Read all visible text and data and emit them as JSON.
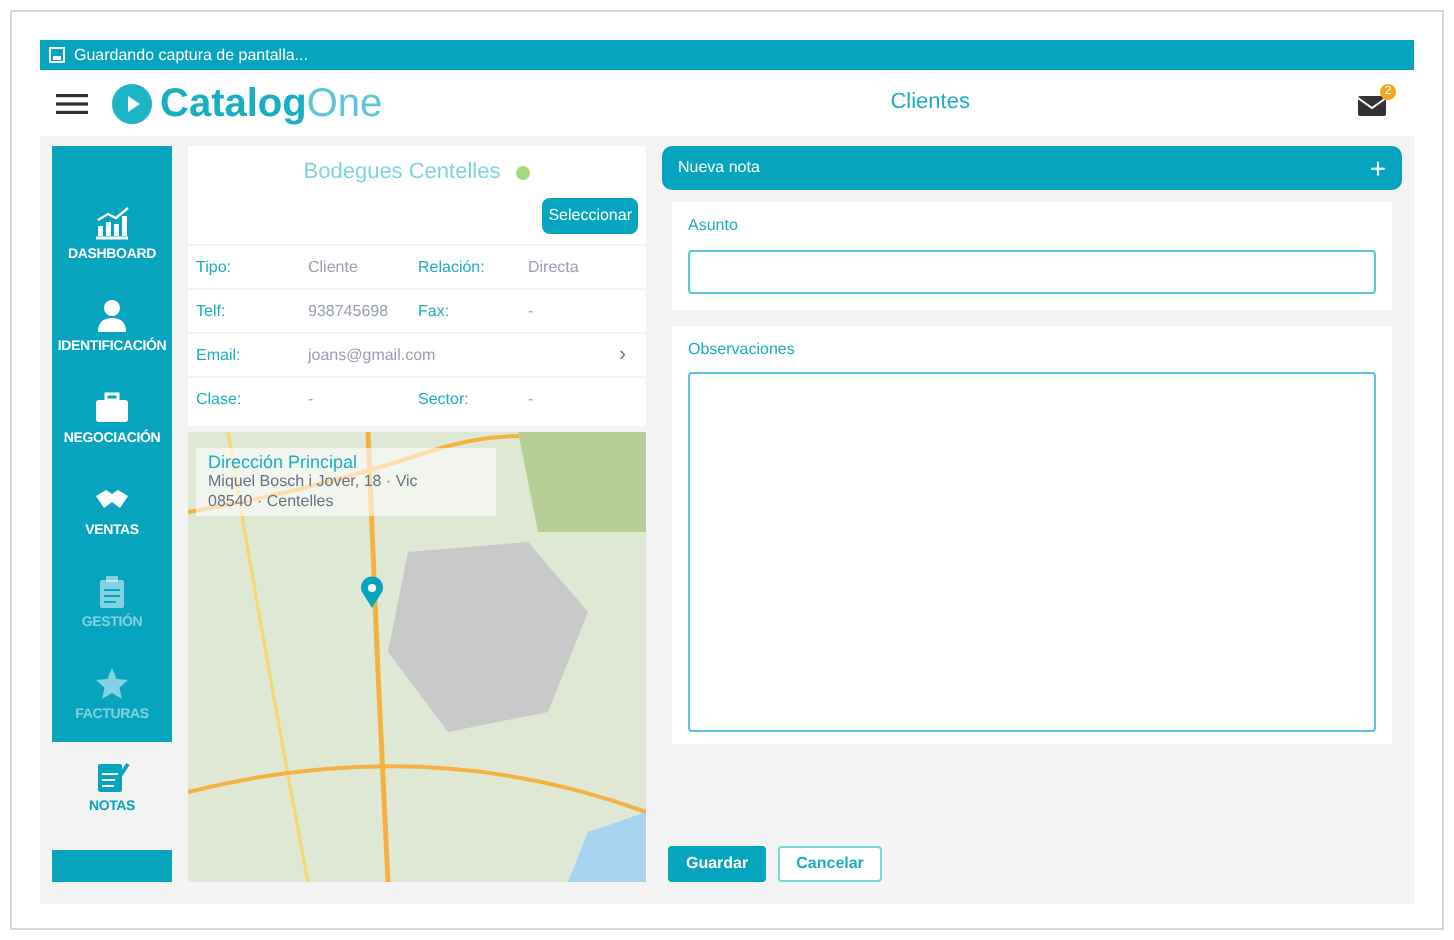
{
  "status_bar": {
    "text": "Guardando captura de pantalla..."
  },
  "header": {
    "logo_first": "Catalog",
    "logo_second": "One",
    "title": "Clientes",
    "notification_count": "2"
  },
  "sidebar": {
    "items": [
      {
        "label": "DASHBOARD",
        "selected": false,
        "disabled": false
      },
      {
        "label": "IDENTIFICACIÓN",
        "selected": false,
        "disabled": false
      },
      {
        "label": "NEGOCIACIÓN",
        "selected": false,
        "disabled": false
      },
      {
        "label": "VENTAS",
        "selected": false,
        "disabled": false
      },
      {
        "label": "GESTIÓN",
        "selected": false,
        "disabled": true
      },
      {
        "label": "FACTURAS",
        "selected": false,
        "disabled": true
      },
      {
        "label": "NOTAS",
        "selected": true,
        "disabled": false
      }
    ]
  },
  "client": {
    "name": "Bodegues Centelles",
    "online": true,
    "select_button": "Seleccionar",
    "rows": [
      {
        "label_1": "Tipo:",
        "value_1": "Cliente",
        "label_2": "Relación:",
        "value_2": "Directa"
      },
      {
        "label_1": "Telf:",
        "value_1": "938745698",
        "label_2": "Fax:",
        "value_2": "-"
      },
      {
        "label_1": "Email:",
        "value_1": "joans@gmail.com",
        "chevron": "›"
      },
      {
        "label_1": "Clase:",
        "value_1": "-",
        "label_2": "Sector:",
        "value_2": "-"
      }
    ]
  },
  "map": {
    "title": "Dirección Principal",
    "address_line_1": "Miquel Bosch i Jover, 18 · Vic",
    "address_line_2": "08540 · Centelles"
  },
  "note": {
    "header": "Nueva nota",
    "add": "+",
    "subject_label": "Asunto",
    "observations_label": "Observaciones"
  },
  "buttons": [
    {
      "label": "Guardar",
      "kind": "primary"
    },
    {
      "label": "Cancelar",
      "kind": "secondary"
    }
  ]
}
